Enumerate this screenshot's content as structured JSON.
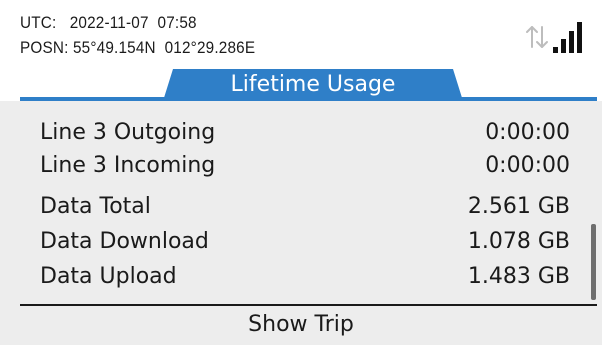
{
  "status": {
    "utc_label": "UTC:",
    "utc_value": "2022-11-07  07:58",
    "posn_label": "POSN:",
    "posn_value": "55°49.154N  012°29.286E",
    "icons": [
      "sync-arrows-icon",
      "signal-strength-icon"
    ],
    "signal_bars": 4
  },
  "tab": {
    "title": "Lifetime Usage"
  },
  "usage_rows": [
    {
      "label": "Line 3 Outgoing",
      "value": "0:00:00"
    },
    {
      "label": "Line 3 Incoming",
      "value": "0:00:00"
    },
    {
      "label": "Data Total",
      "value": "2.561 GB"
    },
    {
      "label": "Data Download",
      "value": "1.078 GB"
    },
    {
      "label": "Data Upload",
      "value": "1.483 GB"
    }
  ],
  "footer": {
    "button_label": "Show Trip"
  },
  "colors": {
    "accent": "#2f7fc8",
    "background": "#ededed",
    "header_bg": "#ffffff",
    "text": "#1a1a1a"
  }
}
